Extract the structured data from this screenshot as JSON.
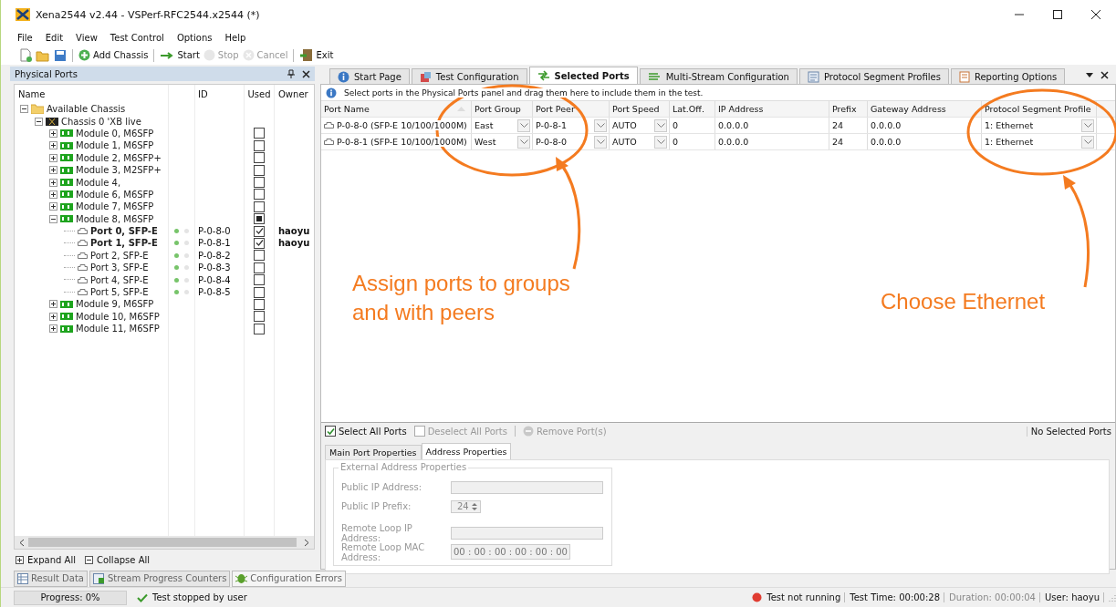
{
  "window": {
    "title": "Xena2544 v2.44 - VSPerf-RFC2544.x2544 (*)"
  },
  "menu": [
    "File",
    "Edit",
    "View",
    "Test Control",
    "Options",
    "Help"
  ],
  "toolbar": [
    {
      "kind": "new",
      "disabled": false
    },
    {
      "kind": "open",
      "disabled": false
    },
    {
      "kind": "save",
      "disabled": false
    },
    {
      "kind": "add",
      "label": "Add Chassis",
      "disabled": false
    },
    {
      "kind": "start",
      "label": "Start",
      "disabled": false
    },
    {
      "kind": "stop",
      "label": "Stop",
      "disabled": true
    },
    {
      "kind": "cancel",
      "label": "Cancel",
      "disabled": true
    },
    {
      "kind": "exit",
      "label": "Exit",
      "disabled": false
    }
  ],
  "physical_ports": {
    "title": "Physical Ports",
    "columns": [
      "Name",
      "ID",
      "Used",
      "Owner"
    ],
    "tree": [
      {
        "kind": "folder",
        "label": "Available Chassis",
        "expanded": true,
        "children": [
          {
            "kind": "chassis",
            "label": "Chassis 0 'XB live",
            "expanded": true,
            "children": [
              {
                "kind": "module",
                "label": "Module 0, M6SFP",
                "expanded": false,
                "checked": false,
                "partial": false
              },
              {
                "kind": "module",
                "label": "Module 1, M6SFP",
                "expanded": false,
                "checked": false,
                "partial": false
              },
              {
                "kind": "module",
                "label": "Module 2, M6SFP+",
                "expanded": false,
                "checked": false,
                "partial": false
              },
              {
                "kind": "module",
                "label": "Module 3, M2SFP+",
                "expanded": false,
                "checked": false,
                "partial": false
              },
              {
                "kind": "module",
                "label": "Module 4,",
                "expanded": false,
                "checked": false,
                "partial": false
              },
              {
                "kind": "module",
                "label": "Module 6, M6SFP",
                "expanded": false,
                "checked": false,
                "partial": false
              },
              {
                "kind": "module",
                "label": "Module 7, M6SFP",
                "expanded": false,
                "checked": false,
                "partial": false
              },
              {
                "kind": "module",
                "label": "Module 8, M6SFP",
                "expanded": true,
                "checked": false,
                "partial": true,
                "children": [
                  {
                    "kind": "port",
                    "label": "Port 0, SFP-E",
                    "link_up": true,
                    "id": "P-0-8-0",
                    "checked": true,
                    "owner": "haoyu"
                  },
                  {
                    "kind": "port",
                    "label": "Port 1, SFP-E",
                    "link_up": true,
                    "id": "P-0-8-1",
                    "checked": true,
                    "owner": "haoyu"
                  },
                  {
                    "kind": "port",
                    "label": "Port 2, SFP-E",
                    "link_up": true,
                    "id": "P-0-8-2",
                    "checked": false
                  },
                  {
                    "kind": "port",
                    "label": "Port 3, SFP-E",
                    "link_up": true,
                    "id": "P-0-8-3",
                    "checked": false
                  },
                  {
                    "kind": "port",
                    "label": "Port 4, SFP-E",
                    "link_up": true,
                    "id": "P-0-8-4",
                    "checked": false
                  },
                  {
                    "kind": "port",
                    "label": "Port 5, SFP-E",
                    "link_up": true,
                    "id": "P-0-8-5",
                    "checked": false
                  }
                ]
              },
              {
                "kind": "module",
                "label": "Module 9, M6SFP",
                "expanded": false,
                "checked": false,
                "partial": false
              },
              {
                "kind": "module",
                "label": "Module 10, M6SFP",
                "expanded": false,
                "checked": false,
                "partial": false
              },
              {
                "kind": "module",
                "label": "Module 11, M6SFP",
                "expanded": false,
                "checked": false,
                "partial": false
              }
            ]
          }
        ]
      }
    ],
    "footer": [
      "Expand All",
      "Collapse All"
    ]
  },
  "tabs": [
    {
      "kind": "info",
      "label": "Start Page",
      "selected": false
    },
    {
      "kind": "cube",
      "label": "Test Configuration",
      "selected": false
    },
    {
      "kind": "ports",
      "label": "Selected Ports",
      "selected": true
    },
    {
      "kind": "streams",
      "label": "Multi-Stream Configuration",
      "selected": false
    },
    {
      "kind": "list",
      "label": "Protocol Segment Profiles",
      "selected": false
    },
    {
      "kind": "report",
      "label": "Reporting Options",
      "selected": false
    }
  ],
  "info": "Select ports in the Physical Ports panel and drag them here to include them in the test.",
  "table": {
    "columns": [
      "Port Name",
      "Port Group",
      "Port Peer",
      "Port Speed",
      "Lat.Off.",
      "IP Address",
      "Prefix",
      "Gateway Address",
      "Protocol Segment Profile"
    ],
    "rows": [
      [
        "P-0-8-0 (SFP-E 10/100/1000M)",
        "East",
        "P-0-8-1",
        "AUTO",
        "0",
        "0.0.0.0",
        "24",
        "0.0.0.0",
        "1: Ethernet"
      ],
      [
        "P-0-8-1 (SFP-E 10/100/1000M)",
        "West",
        "P-0-8-0",
        "AUTO",
        "0",
        "0.0.0.0",
        "24",
        "0.0.0.0",
        "1: Ethernet"
      ]
    ]
  },
  "port_actions": [
    {
      "kind": "checkbox",
      "label": "Select All Ports",
      "checked": true,
      "disabled": false
    },
    {
      "kind": "checkbox",
      "label": "Deselect All Ports",
      "checked": false,
      "disabled": true
    },
    {
      "kind": "button",
      "label": "Remove Port(s)",
      "disabled": true
    }
  ],
  "selected_count": "No Selected Ports",
  "property_tabs": [
    {
      "label": "Main Port Properties",
      "selected": false
    },
    {
      "label": "Address Properties",
      "selected": true
    }
  ],
  "address_group": {
    "title": "External Address Properties",
    "fields": [
      {
        "kind": "text",
        "label": "Public IP Address:"
      },
      {
        "kind": "spinner",
        "label": "Public IP Prefix:",
        "value": "24"
      },
      {
        "kind": "text",
        "label": "Remote Loop IP Address:"
      },
      {
        "kind": "mac",
        "label": "Remote Loop MAC Address:",
        "value": "00 : 00 : 00 : 00 : 00 : 00"
      }
    ]
  },
  "bottom_tabs": [
    {
      "kind": "table",
      "label": "Result Data",
      "selected": false
    },
    {
      "kind": "counters",
      "label": "Stream Progress Counters",
      "selected": false
    },
    {
      "kind": "bug",
      "label": "Configuration Errors",
      "selected": true
    }
  ],
  "status_bar": {
    "progress": "Progress: 0%",
    "message": "Test stopped by user",
    "state": "Test not running",
    "test_time": "Test Time: 00:00:28",
    "duration": "Duration: 00:00:04",
    "user": "User: haoyu"
  },
  "annotations": [
    "Assign ports to groups and with peers",
    "Choose Ethernet"
  ]
}
